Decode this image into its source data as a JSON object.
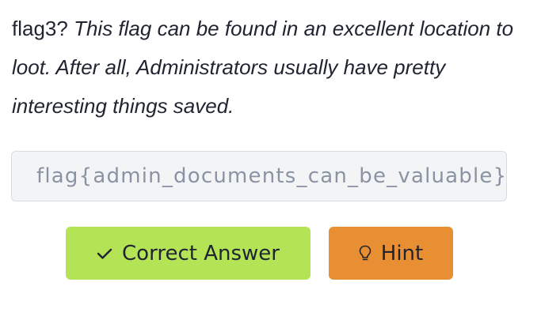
{
  "question": {
    "label": "flag3?",
    "text": "This flag can be found in an excellent location to loot. After all, Administrators usually have pretty interesting things saved."
  },
  "answer": {
    "value": "flag{admin_documents_can_be_valuable}"
  },
  "buttons": {
    "correct": {
      "label": "Correct Answer",
      "icon": "check-icon",
      "color": "#b4e356"
    },
    "hint": {
      "label": "Hint",
      "icon": "lightbulb-icon",
      "color": "#e98f33"
    }
  }
}
